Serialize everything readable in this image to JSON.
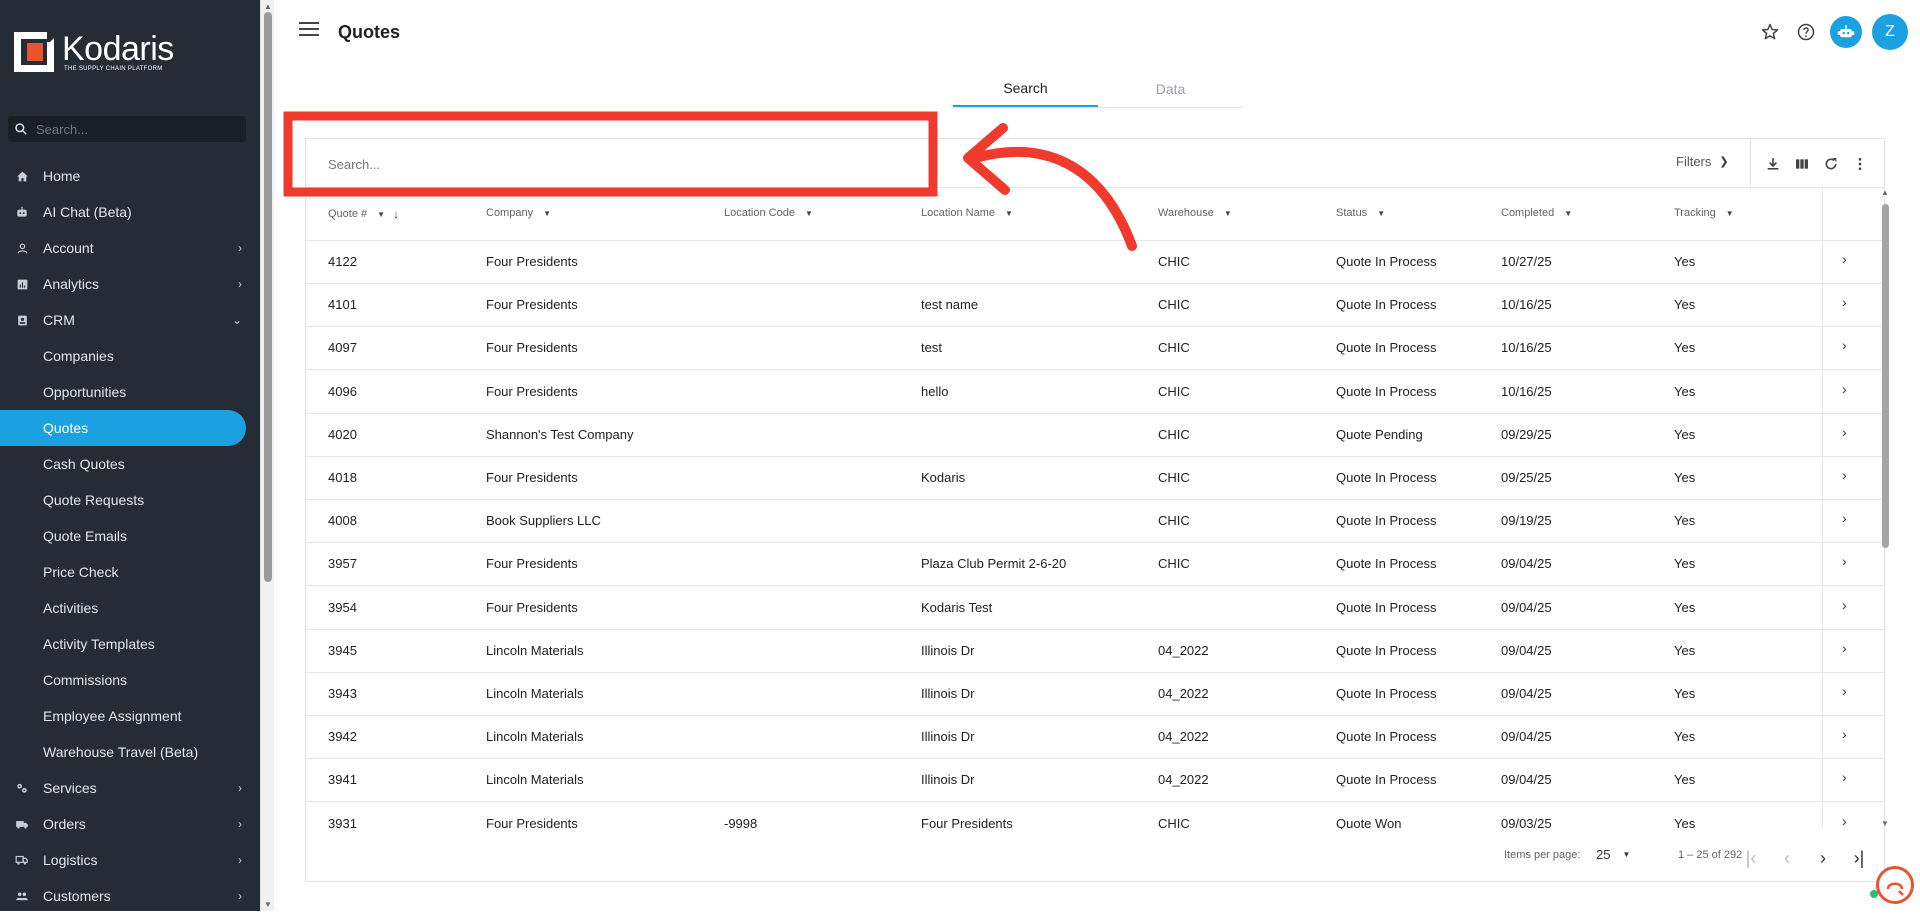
{
  "brand": {
    "name": "Kodaris",
    "tagline": "THE SUPPLY CHAIN PLATFORM",
    "accent": "#1ba0e2",
    "logo_color": "#e8552d"
  },
  "sidebar": {
    "search_placeholder": "Search...",
    "items": [
      {
        "label": "Home",
        "icon": "home-icon"
      },
      {
        "label": "AI Chat (Beta)",
        "icon": "bot-icon"
      },
      {
        "label": "Account",
        "icon": "account-icon",
        "expandable": true
      },
      {
        "label": "Analytics",
        "icon": "analytics-icon",
        "expandable": true
      },
      {
        "label": "CRM",
        "icon": "crm-icon",
        "expanded": true
      }
    ],
    "crm_children": [
      "Companies",
      "Opportunities",
      "Quotes",
      "Cash Quotes",
      "Quote Requests",
      "Quote Emails",
      "Price Check",
      "Activities",
      "Activity Templates",
      "Commissions",
      "Employee Assignment",
      "Warehouse Travel (Beta)"
    ],
    "active_child": "Quotes",
    "more_items": [
      {
        "label": "Services",
        "icon": "services-icon"
      },
      {
        "label": "Orders",
        "icon": "orders-icon"
      },
      {
        "label": "Logistics",
        "icon": "truck-icon"
      },
      {
        "label": "Customers",
        "icon": "customers-icon"
      }
    ]
  },
  "header": {
    "title": "Quotes",
    "avatar_initial": "Z"
  },
  "tabs": [
    {
      "label": "Search",
      "active": true
    },
    {
      "label": "Data",
      "active": false
    }
  ],
  "toolbar": {
    "search_placeholder": "Search...",
    "filters_label": "Filters"
  },
  "table": {
    "columns": [
      "Quote #",
      "Company",
      "Location Code",
      "Location Name",
      "Warehouse",
      "Status",
      "Completed",
      "Tracking"
    ],
    "rows": [
      [
        "4122",
        "Four Presidents",
        "",
        "",
        "CHIC",
        "Quote In Process",
        "10/27/25",
        "Yes"
      ],
      [
        "4101",
        "Four Presidents",
        "",
        "test name",
        "CHIC",
        "Quote In Process",
        "10/16/25",
        "Yes"
      ],
      [
        "4097",
        "Four Presidents",
        "",
        "test",
        "CHIC",
        "Quote In Process",
        "10/16/25",
        "Yes"
      ],
      [
        "4096",
        "Four Presidents",
        "",
        "hello",
        "CHIC",
        "Quote In Process",
        "10/16/25",
        "Yes"
      ],
      [
        "4020",
        "Shannon's Test Company",
        "",
        "",
        "CHIC",
        "Quote Pending",
        "09/29/25",
        "Yes"
      ],
      [
        "4018",
        "Four Presidents",
        "",
        "Kodaris",
        "CHIC",
        "Quote In Process",
        "09/25/25",
        "Yes"
      ],
      [
        "4008",
        "Book Suppliers LLC",
        "",
        "",
        "CHIC",
        "Quote In Process",
        "09/19/25",
        "Yes"
      ],
      [
        "3957",
        "Four Presidents",
        "",
        "Plaza Club Permit 2-6-20",
        "CHIC",
        "Quote In Process",
        "09/04/25",
        "Yes"
      ],
      [
        "3954",
        "Four Presidents",
        "",
        "Kodaris Test",
        "",
        "Quote In Process",
        "09/04/25",
        "Yes"
      ],
      [
        "3945",
        "Lincoln Materials",
        "",
        "Illinois Dr",
        "04_2022",
        "Quote In Process",
        "09/04/25",
        "Yes"
      ],
      [
        "3943",
        "Lincoln Materials",
        "",
        "Illinois Dr",
        "04_2022",
        "Quote In Process",
        "09/04/25",
        "Yes"
      ],
      [
        "3942",
        "Lincoln Materials",
        "",
        "Illinois Dr",
        "04_2022",
        "Quote In Process",
        "09/04/25",
        "Yes"
      ],
      [
        "3941",
        "Lincoln Materials",
        "",
        "Illinois Dr",
        "04_2022",
        "Quote In Process",
        "09/04/25",
        "Yes"
      ],
      [
        "3931",
        "Four Presidents",
        "-9998",
        "Four Presidents",
        "CHIC",
        "Quote Won",
        "09/03/25",
        "Yes"
      ]
    ]
  },
  "pager": {
    "items_per_page_label": "Items per page:",
    "page_size": "25",
    "range": "1 – 25 of 292"
  },
  "annotation": {
    "color": "#f03a2e"
  }
}
